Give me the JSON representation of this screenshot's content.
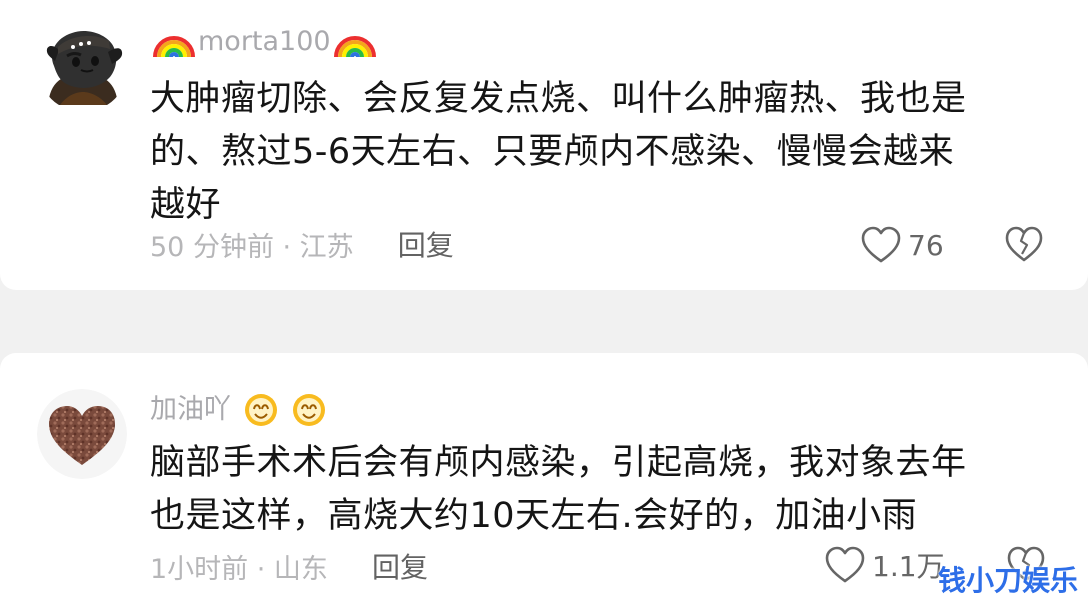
{
  "comments": [
    {
      "username": "morta100",
      "badge": "rainbow-icon",
      "text_lines": [
        "大肿瘤切除、会反复发点烧、叫什么肿瘤热、我也是",
        "的、熬过5-6天左右、只要颅内不感染、慢慢会越来",
        "越好"
      ],
      "meta": "50 分钟前 · 江苏",
      "reply_label": "回复",
      "likes": "76"
    },
    {
      "username": "加油吖",
      "badge": "smile-icon",
      "text_lines": [
        "脑部手术术后会有颅内感染，引起高烧，我对象去年",
        "也是这样，高烧大约10天左右.会好的，加油小雨"
      ],
      "meta": "1小时前 · 山东",
      "reply_label": "回复",
      "likes": "1.1万"
    }
  ],
  "watermark": "钱小刀娱乐",
  "colors": {
    "background": "#f1f1f1",
    "card": "#ffffff",
    "username": "#a9a9ad",
    "text": "#151515",
    "meta": "#b6b6b8",
    "reply": "#636363",
    "watermark": "#2d6ee8"
  },
  "icons": [
    "rainbow-icon",
    "smile-icon",
    "heart-icon",
    "broken-heart-icon"
  ]
}
